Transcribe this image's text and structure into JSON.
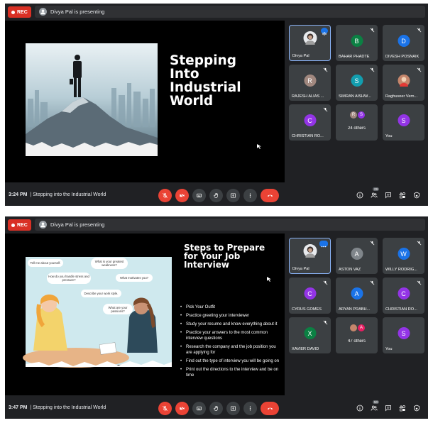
{
  "screens": [
    {
      "rec_label": "REC",
      "presenting": "Divya Pal is presenting",
      "time": "3:24 PM",
      "meeting": "Stepping into the Industrial World",
      "people_count": "29",
      "slide": {
        "title": "Stepping Into Industrial World"
      },
      "tiles": [
        {
          "name": "Divya Pal",
          "initial": "",
          "color": "#e8eaed",
          "icon": "speaking-indicator-icon",
          "active": true
        },
        {
          "name": "BAHAR PHADTE",
          "initial": "B",
          "color": "#0b8043",
          "icon": "mic-off-icon",
          "active": false
        },
        {
          "name": "DIVESH POSNAIK",
          "initial": "D",
          "color": "#1a73e8",
          "icon": "mic-off-icon",
          "active": false
        },
        {
          "name": "RAJESH ALIAS ...",
          "initial": "R",
          "color": "#a1887f",
          "icon": "mic-off-icon",
          "active": false
        },
        {
          "name": "SIMRAN AISHW...",
          "initial": "S",
          "color": "#129eaf",
          "icon": "mic-off-icon",
          "active": false
        },
        {
          "name": "Raghuveer Vern...",
          "initial": "",
          "color": "#c5866c",
          "icon": "mic-off-icon",
          "active": false
        },
        {
          "name": "CHRISTIAN RO...",
          "initial": "C",
          "color": "#9334e6",
          "icon": "mic-off-icon",
          "active": false
        },
        {
          "name": "24 others",
          "initial": "R S",
          "color": "#a1887f",
          "icon": "",
          "active": false
        },
        {
          "name": "You",
          "initial": "S",
          "color": "#9334e6",
          "icon": "",
          "active": false
        }
      ]
    },
    {
      "rec_label": "REC",
      "presenting": "Divya Pal is presenting",
      "time": "3:47 PM",
      "meeting": "Stepping into the Industrial World",
      "people_count": "50",
      "slide": {
        "title": "Steps to Prepare for Your Job Interview",
        "bullets": [
          "Pick Your Outfit",
          "Practice greeting your interviewer",
          "Study your resume and know everything about it",
          "Practice your answers to the most common interview questions",
          "Research the company and the job position you are applying for",
          "Find out the type of interview you will be going on",
          "Print out the directions to the interview and be on time"
        ],
        "bubbles": [
          "Tell me about yourself.",
          "What is your greatest weakness?",
          "How do you handle stress and pressure?",
          "What motivates you?",
          "Describe your work style.",
          "What are your passions?"
        ]
      },
      "tiles": [
        {
          "name": "Divya Pal",
          "initial": "",
          "color": "#e8eaed",
          "icon": "more-options-icon",
          "active": true
        },
        {
          "name": "ASTON VAZ",
          "initial": "A",
          "color": "#80868b",
          "icon": "mic-off-icon",
          "active": false
        },
        {
          "name": "WILLY RODRIG...",
          "initial": "W",
          "color": "#1a73e8",
          "icon": "mic-off-icon",
          "active": false
        },
        {
          "name": "CYRUS GOMES",
          "initial": "C",
          "color": "#9334e6",
          "icon": "mic-off-icon",
          "active": false
        },
        {
          "name": "ARYAN PRABH...",
          "initial": "A",
          "color": "#1a73e8",
          "icon": "mic-off-icon",
          "active": false
        },
        {
          "name": "CHRISTIAN RO...",
          "initial": "C",
          "color": "#9334e6",
          "icon": "mic-off-icon",
          "active": false
        },
        {
          "name": "XAVIER DAVID",
          "initial": "X",
          "color": "#0b8043",
          "icon": "mic-off-icon",
          "active": false
        },
        {
          "name": "47 others",
          "initial": "A",
          "color": "#e91e63",
          "icon": "",
          "active": false
        },
        {
          "name": "You",
          "initial": "S",
          "color": "#9334e6",
          "icon": "",
          "active": false
        }
      ]
    }
  ]
}
